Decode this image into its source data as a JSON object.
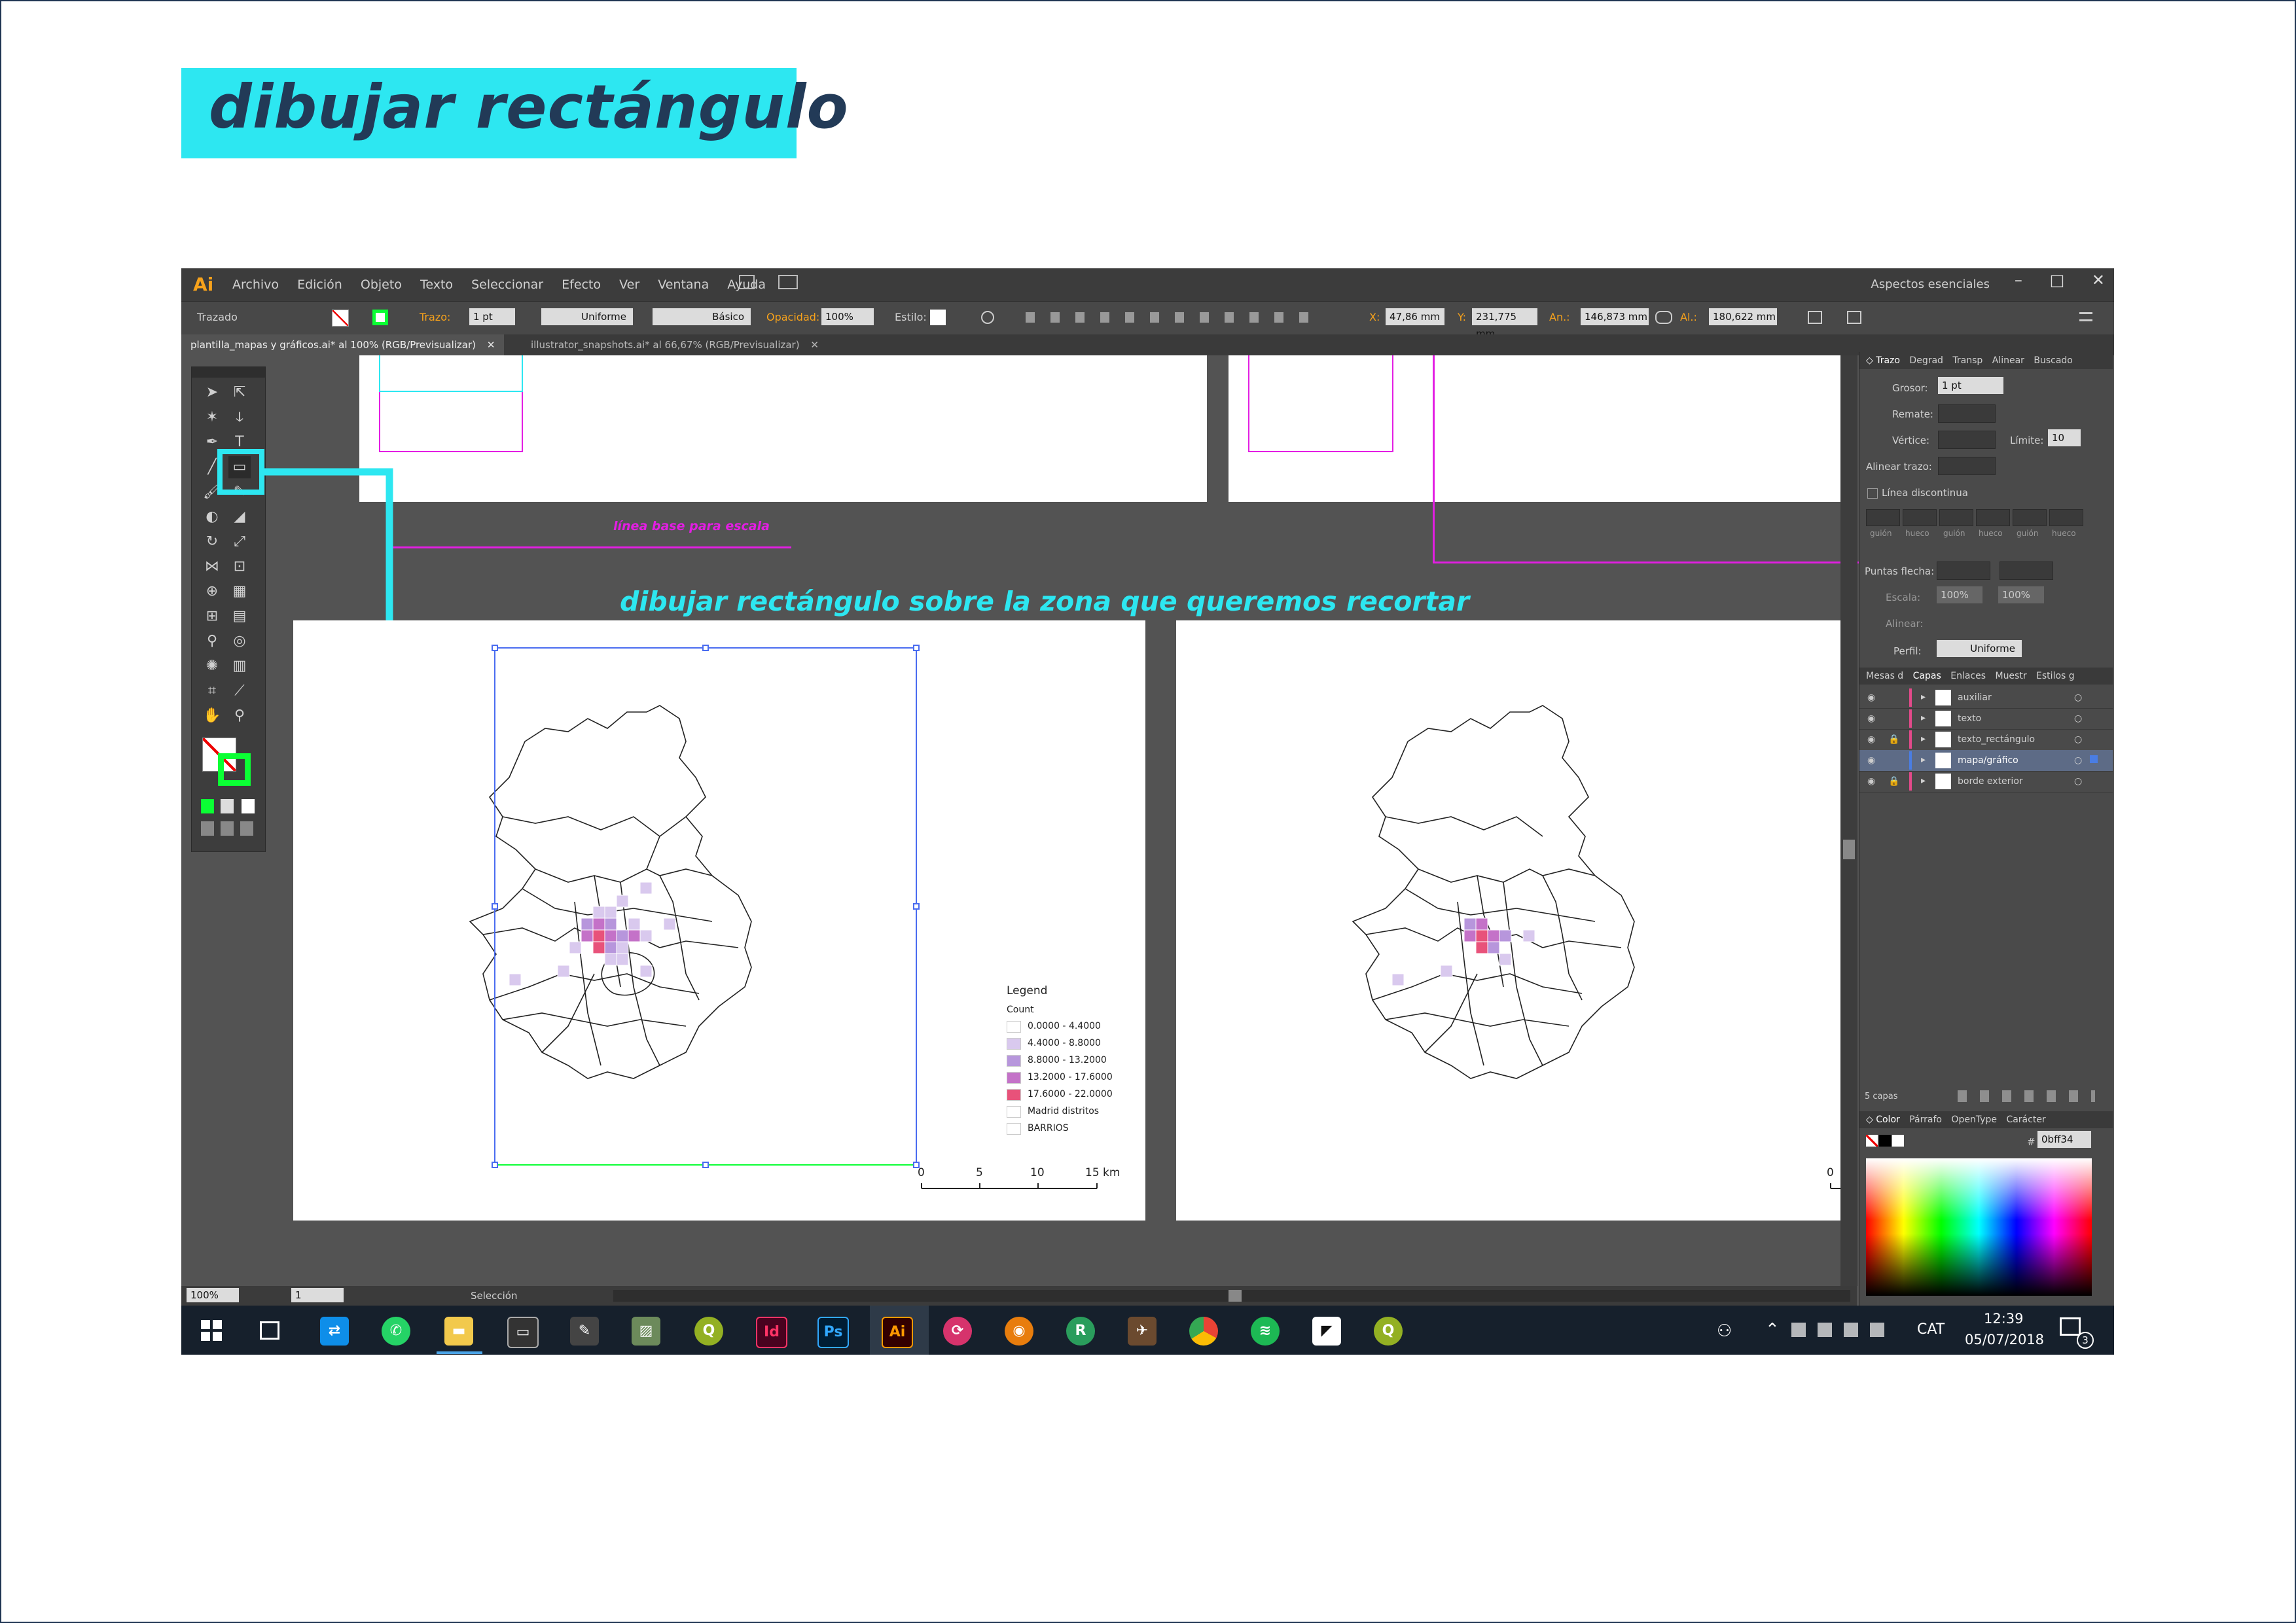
{
  "heading": "dibujar rectángulo",
  "app": {
    "logo": "Ai",
    "menus": [
      "Archivo",
      "Edición",
      "Objeto",
      "Texto",
      "Seleccionar",
      "Efecto",
      "Ver",
      "Ventana",
      "Ayuda"
    ],
    "workspace": "Aspectos esenciales",
    "window_controls": [
      "–",
      "□",
      "✕"
    ]
  },
  "control_bar": {
    "mode": "Trazado",
    "stroke_label": "Trazo:",
    "stroke_value": "1 pt",
    "profile": "Uniforme",
    "brush": "Básico",
    "opacity_label": "Opacidad:",
    "opacity_value": "100%",
    "style_label": "Estilo:",
    "x_label": "X:",
    "x_value": "47,86 mm",
    "y_label": "Y:",
    "y_value": "231,775 mm",
    "w_label": "An.:",
    "w_value": "146,873 mm",
    "h_label": "Al.:",
    "h_value": "180,622 mm"
  },
  "doc_tabs": [
    {
      "label": "plantilla_mapas y gráficos.ai* al 100% (RGB/Previsualizar)",
      "close": "✕"
    },
    {
      "label": "illustrator_snapshots.ai* al 66,67% (RGB/Previsualizar)",
      "close": "✕"
    }
  ],
  "artboard_note": "línea base para escala",
  "annotation": "dibujar rectángulo sobre la zona que queremos recortar",
  "legend": {
    "title": "Legend",
    "field": "Count",
    "classes": [
      {
        "label": "0.0000 - 4.4000",
        "color": "#ffffff"
      },
      {
        "label": "4.4000 - 8.8000",
        "color": "#d9c9ee"
      },
      {
        "label": "8.8000 - 13.2000",
        "color": "#b796dc"
      },
      {
        "label": "13.2000 - 17.6000",
        "color": "#c472c8"
      },
      {
        "label": "17.6000 - 22.0000",
        "color": "#e8527a"
      }
    ],
    "districts": "Madrid distritos",
    "barrios": "BARRIOS"
  },
  "scale": {
    "ticks": [
      "0",
      "5",
      "10",
      "15 km"
    ]
  },
  "scale_right": {
    "ticks": [
      "0"
    ]
  },
  "stroke_panel": {
    "tabs": [
      "◇ Trazo",
      "Degrad",
      "Transp",
      "Alinear",
      "Buscado"
    ],
    "weight_label": "Grosor:",
    "weight_value": "1 pt",
    "cap_label": "Remate:",
    "corner_label": "Vértice:",
    "limit_label": "Límite:",
    "limit_value": "10",
    "align_label": "Alinear trazo:",
    "dashed_label": "Línea discontinua",
    "dash_labels": [
      "guión",
      "hueco",
      "guión",
      "hueco",
      "guión",
      "hueco"
    ],
    "arrows_label": "Puntas flecha:",
    "scale_label": "Escala:",
    "scale_a": "100%",
    "scale_b": "100%",
    "align2_label": "Alinear:",
    "profile_label": "Perfil:",
    "profile_value": "Uniforme"
  },
  "layers_panel": {
    "tabs": [
      "Mesas d",
      "Capas",
      "Enlaces",
      "Muestr",
      "Estilos g"
    ],
    "layers": [
      {
        "name": "auxiliar",
        "color": "#e34a8a"
      },
      {
        "name": "texto",
        "color": "#e34a8a"
      },
      {
        "name": "texto_rectángulo",
        "color": "#e34a8a"
      },
      {
        "name": "mapa/gráfico",
        "color": "#4a7de3"
      },
      {
        "name": "borde exterior",
        "color": "#e34a8a"
      }
    ],
    "count": "5 capas"
  },
  "color_panel": {
    "tabs": [
      "◇ Color",
      "Párrafo",
      "OpenType",
      "Carácter"
    ],
    "hex_label": "#",
    "hex_value": "0bff34"
  },
  "status": {
    "zoom": "100%",
    "page": "1",
    "tool": "Selección"
  },
  "taskbar": {
    "lang": "CAT",
    "time": "12:39",
    "date": "05/07/2018",
    "notif": "3",
    "apps": [
      "teamviewer",
      "whatsapp",
      "explorer",
      "terminal",
      "inkscape",
      "photos",
      "qgis",
      "indesign",
      "photoshop",
      "illustrator",
      "sync",
      "blender",
      "r",
      "kerbal",
      "chrome",
      "spotify",
      "sticky",
      "qgis2"
    ],
    "app_labels": {
      "id": "Id",
      "ps": "Ps",
      "ai": "Ai"
    }
  },
  "colors": {
    "accent": "#2de7f1",
    "fill_green": "#0bff34",
    "magenta": "#e31ee3",
    "selection_blue": "#4a6cf0"
  }
}
